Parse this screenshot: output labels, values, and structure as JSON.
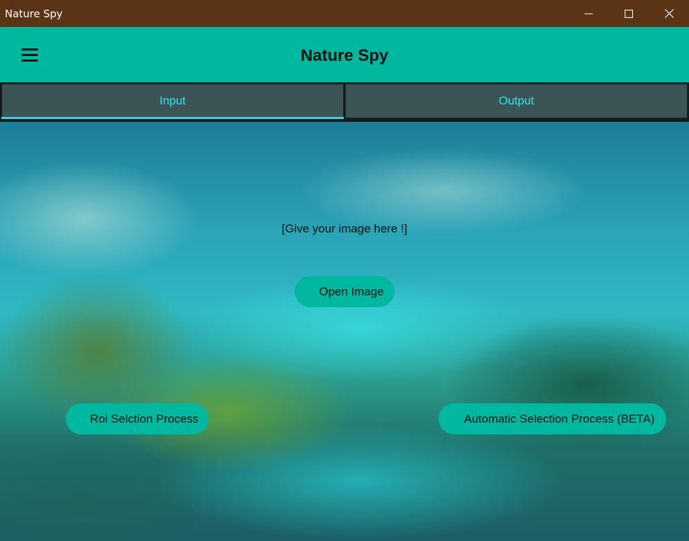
{
  "window": {
    "title": "Nature Spy",
    "controls": [
      "minimize-icon",
      "maximize-icon",
      "close-icon"
    ]
  },
  "appbar": {
    "menu_icon": "hamburger-menu-icon",
    "title": "Nature Spy"
  },
  "tabs": [
    {
      "label": "Input",
      "selected": true
    },
    {
      "label": "Output",
      "selected": false
    }
  ],
  "main": {
    "prompt": "[Give your image here !]",
    "open_button": "Open Image",
    "roi_button": "Roi Selction Process",
    "auto_button": "Automatic Selection Process (BETA)"
  },
  "colors": {
    "titlebar": "#5b3315",
    "accent": "#00b7a0",
    "tab_background": "#3b5557",
    "tab_text": "#29e7f0"
  }
}
